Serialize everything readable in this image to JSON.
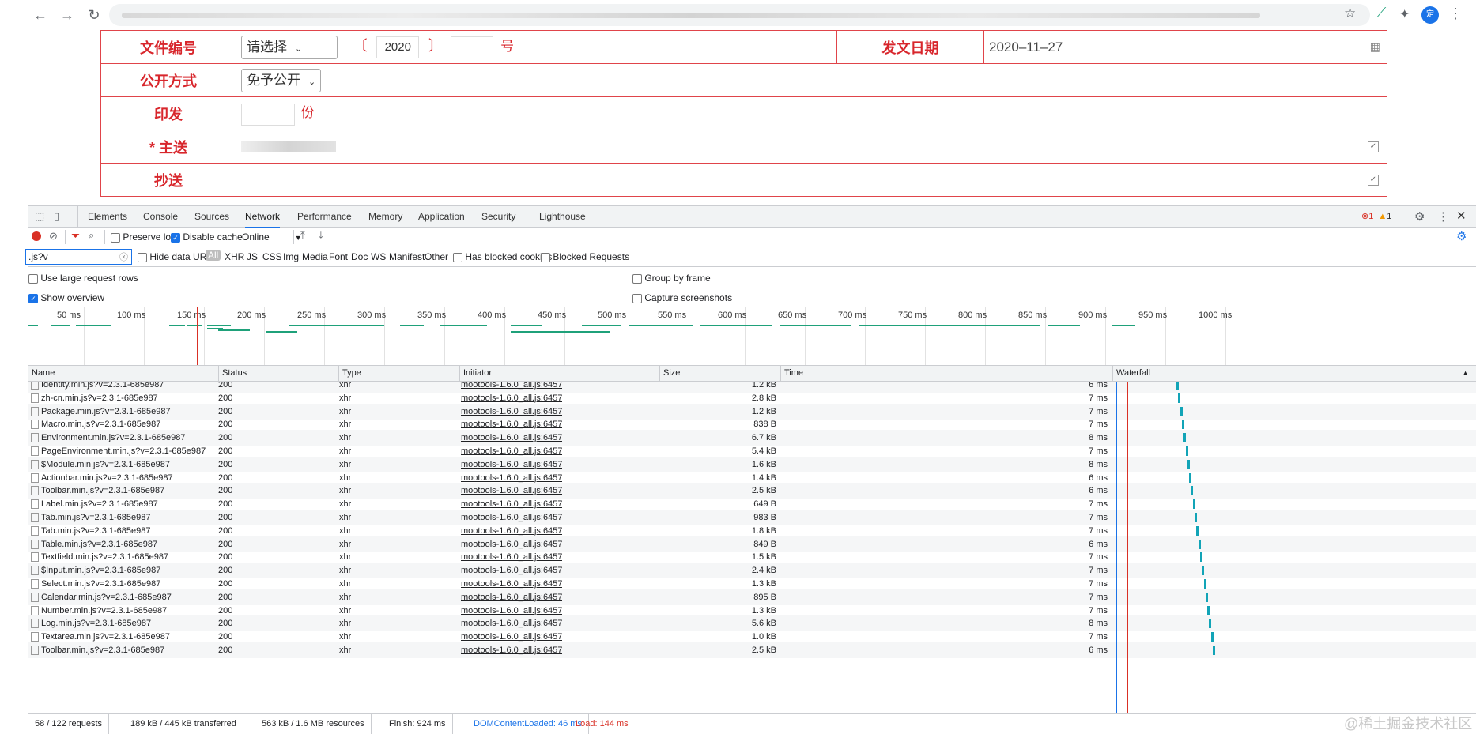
{
  "browser": {
    "back_icon": "←",
    "forward_icon": "→",
    "reload_icon": "↻",
    "avatar_text": "定"
  },
  "form": {
    "doc_number_label": "文件编号",
    "doc_select_value": "请选择",
    "bracket_open": "〔",
    "year_value": "2020",
    "bracket_close": "〕",
    "number_suffix": "号",
    "issue_date_label": "发文日期",
    "issue_date_value": "2020–11–27",
    "public_label": "公开方式",
    "public_select_value": "免予公开",
    "print_label": "印发",
    "copies_suffix": "份",
    "main_send_label": "* 主送",
    "cc_label": "抄送"
  },
  "devtools": {
    "tabs": [
      "Elements",
      "Console",
      "Sources",
      "Network",
      "Performance",
      "Memory",
      "Application",
      "Security",
      "Lighthouse"
    ],
    "active_tab": "Network",
    "error_count": "1",
    "warning_count": "1",
    "toolbar": {
      "preserve_log": "Preserve log",
      "disable_cache": "Disable cache",
      "throttle": "Online"
    },
    "filter": {
      "value": ".js?v",
      "hide_data_urls": "Hide data URLs",
      "types": [
        "All",
        "XHR",
        "JS",
        "CSS",
        "Img",
        "Media",
        "Font",
        "Doc",
        "WS",
        "Manifest",
        "Other"
      ],
      "has_blocked_cookies": "Has blocked cookies",
      "blocked_requests": "Blocked Requests"
    },
    "options": {
      "large_rows": "Use large request rows",
      "show_overview": "Show overview",
      "group_by_frame": "Group by frame",
      "capture_screenshots": "Capture screenshots"
    },
    "overview_ticks": [
      "50 ms",
      "100 ms",
      "150 ms",
      "200 ms",
      "250 ms",
      "300 ms",
      "350 ms",
      "400 ms",
      "450 ms",
      "500 ms",
      "550 ms",
      "600 ms",
      "650 ms",
      "700 ms",
      "750 ms",
      "800 ms",
      "850 ms",
      "900 ms",
      "950 ms",
      "1000 ms"
    ],
    "columns": [
      "Name",
      "Status",
      "Type",
      "Initiator",
      "Size",
      "Time",
      "Waterfall"
    ],
    "rows": [
      {
        "name": "Identity.min.js?v=2.3.1-685e987",
        "status": "200",
        "type": "xhr",
        "initiator": "mootools-1.6.0_all.js:6457",
        "size": "1.2 kB",
        "time": "6 ms"
      },
      {
        "name": "zh-cn.min.js?v=2.3.1-685e987",
        "status": "200",
        "type": "xhr",
        "initiator": "mootools-1.6.0_all.js:6457",
        "size": "2.8 kB",
        "time": "7 ms"
      },
      {
        "name": "Package.min.js?v=2.3.1-685e987",
        "status": "200",
        "type": "xhr",
        "initiator": "mootools-1.6.0_all.js:6457",
        "size": "1.2 kB",
        "time": "7 ms"
      },
      {
        "name": "Macro.min.js?v=2.3.1-685e987",
        "status": "200",
        "type": "xhr",
        "initiator": "mootools-1.6.0_all.js:6457",
        "size": "838 B",
        "time": "7 ms"
      },
      {
        "name": "Environment.min.js?v=2.3.1-685e987",
        "status": "200",
        "type": "xhr",
        "initiator": "mootools-1.6.0_all.js:6457",
        "size": "6.7 kB",
        "time": "8 ms"
      },
      {
        "name": "PageEnvironment.min.js?v=2.3.1-685e987",
        "status": "200",
        "type": "xhr",
        "initiator": "mootools-1.6.0_all.js:6457",
        "size": "5.4 kB",
        "time": "7 ms"
      },
      {
        "name": "$Module.min.js?v=2.3.1-685e987",
        "status": "200",
        "type": "xhr",
        "initiator": "mootools-1.6.0_all.js:6457",
        "size": "1.6 kB",
        "time": "8 ms"
      },
      {
        "name": "Actionbar.min.js?v=2.3.1-685e987",
        "status": "200",
        "type": "xhr",
        "initiator": "mootools-1.6.0_all.js:6457",
        "size": "1.4 kB",
        "time": "6 ms"
      },
      {
        "name": "Toolbar.min.js?v=2.3.1-685e987",
        "status": "200",
        "type": "xhr",
        "initiator": "mootools-1.6.0_all.js:6457",
        "size": "2.5 kB",
        "time": "6 ms"
      },
      {
        "name": "Label.min.js?v=2.3.1-685e987",
        "status": "200",
        "type": "xhr",
        "initiator": "mootools-1.6.0_all.js:6457",
        "size": "649 B",
        "time": "7 ms"
      },
      {
        "name": "Tab.min.js?v=2.3.1-685e987",
        "status": "200",
        "type": "xhr",
        "initiator": "mootools-1.6.0_all.js:6457",
        "size": "983 B",
        "time": "7 ms"
      },
      {
        "name": "Tab.min.js?v=2.3.1-685e987",
        "status": "200",
        "type": "xhr",
        "initiator": "mootools-1.6.0_all.js:6457",
        "size": "1.8 kB",
        "time": "7 ms"
      },
      {
        "name": "Table.min.js?v=2.3.1-685e987",
        "status": "200",
        "type": "xhr",
        "initiator": "mootools-1.6.0_all.js:6457",
        "size": "849 B",
        "time": "6 ms"
      },
      {
        "name": "Textfield.min.js?v=2.3.1-685e987",
        "status": "200",
        "type": "xhr",
        "initiator": "mootools-1.6.0_all.js:6457",
        "size": "1.5 kB",
        "time": "7 ms"
      },
      {
        "name": "$Input.min.js?v=2.3.1-685e987",
        "status": "200",
        "type": "xhr",
        "initiator": "mootools-1.6.0_all.js:6457",
        "size": "2.4 kB",
        "time": "7 ms"
      },
      {
        "name": "Select.min.js?v=2.3.1-685e987",
        "status": "200",
        "type": "xhr",
        "initiator": "mootools-1.6.0_all.js:6457",
        "size": "1.3 kB",
        "time": "7 ms"
      },
      {
        "name": "Calendar.min.js?v=2.3.1-685e987",
        "status": "200",
        "type": "xhr",
        "initiator": "mootools-1.6.0_all.js:6457",
        "size": "895 B",
        "time": "7 ms"
      },
      {
        "name": "Number.min.js?v=2.3.1-685e987",
        "status": "200",
        "type": "xhr",
        "initiator": "mootools-1.6.0_all.js:6457",
        "size": "1.3 kB",
        "time": "7 ms"
      },
      {
        "name": "Log.min.js?v=2.3.1-685e987",
        "status": "200",
        "type": "xhr",
        "initiator": "mootools-1.6.0_all.js:6457",
        "size": "5.6 kB",
        "time": "8 ms"
      },
      {
        "name": "Textarea.min.js?v=2.3.1-685e987",
        "status": "200",
        "type": "xhr",
        "initiator": "mootools-1.6.0_all.js:6457",
        "size": "1.0 kB",
        "time": "7 ms"
      },
      {
        "name": "Toolbar.min.js?v=2.3.1-685e987",
        "status": "200",
        "type": "xhr",
        "initiator": "mootools-1.6.0_all.js:6457",
        "size": "2.5 kB",
        "time": "6 ms"
      }
    ],
    "status": {
      "requests": "58 / 122 requests",
      "transferred": "189 kB / 445 kB transferred",
      "resources": "563 kB / 1.6 MB resources",
      "finish": "Finish: 924 ms",
      "dcl": "DOMContentLoaded: 46 ms",
      "load": "Load: 144 ms"
    },
    "colors": {
      "dcl": "#1a73e8",
      "load": "#d93025",
      "bar": "#12a4b7"
    }
  },
  "watermark": "@稀土掘金技术社区"
}
